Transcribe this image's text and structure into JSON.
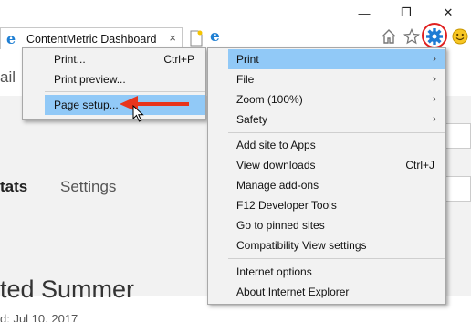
{
  "browser": {
    "tab_title": "ContentMetric Dashboard",
    "tab_close": "×",
    "window_controls": [
      "—",
      "❐",
      "✕"
    ],
    "toolbar_icons": [
      "home-icon",
      "favorites-star-icon",
      "tools-gear-icon",
      "smiley-feedback-icon"
    ],
    "annotation_color": "#e02020"
  },
  "page": {
    "nav_partial": "ail",
    "tab_partial": "tats",
    "tab_settings": "Settings",
    "title_partial": "ted Summer",
    "date_partial": "d: Jul 10, 2017"
  },
  "print_submenu": {
    "items": [
      {
        "label": "Print...",
        "shortcut": "Ctrl+P"
      },
      {
        "label": "Print preview...",
        "shortcut": ""
      },
      {
        "label": "Page setup...",
        "shortcut": ""
      }
    ],
    "highlight_color": "#91c9f7"
  },
  "tools_menu": {
    "items": [
      {
        "label": "Print",
        "submenu": true
      },
      {
        "label": "File",
        "submenu": true
      },
      {
        "label": "Zoom (100%)",
        "submenu": true
      },
      {
        "label": "Safety",
        "submenu": true
      },
      {
        "label": "Add site to Apps"
      },
      {
        "label": "View downloads",
        "shortcut": "Ctrl+J"
      },
      {
        "label": "Manage add-ons"
      },
      {
        "label": "F12 Developer Tools"
      },
      {
        "label": "Go to pinned sites"
      },
      {
        "label": "Compatibility View settings"
      },
      {
        "label": "Internet options"
      },
      {
        "label": "About Internet Explorer"
      }
    ],
    "arrow": "›"
  }
}
